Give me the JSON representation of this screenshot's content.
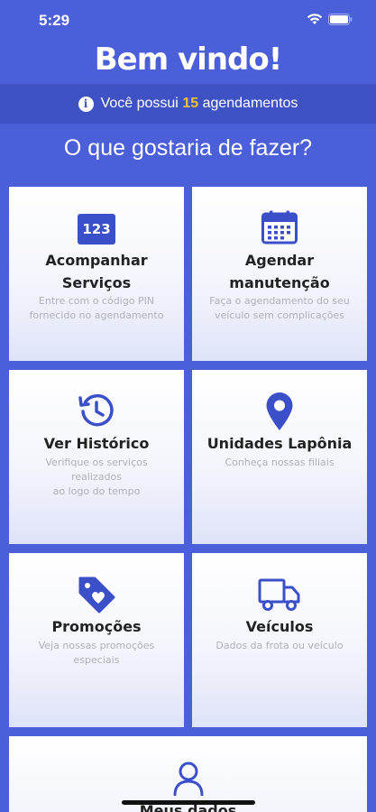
{
  "status_bar": {
    "time": "5:29",
    "icons": [
      "wifi-icon",
      "battery-icon"
    ]
  },
  "header": {
    "title": "Bem vindo!",
    "info_prefix": "Você possui",
    "appointments_count": "15",
    "info_suffix": "agendamentos"
  },
  "question": "O que gostaria de fazer?",
  "cards": [
    {
      "icon": "pin-code-icon",
      "icon_text": "123",
      "title_line1": "Acompanhar",
      "title_line2": "Serviços",
      "desc_line1": "Entre com o código PIN",
      "desc_line2": "fornecido no agendamento"
    },
    {
      "icon": "calendar-icon",
      "title_line1": "Agendar",
      "title_line2": "manutenção",
      "desc_line1": "Faça o agendamento do seu",
      "desc_line2": "veículo sem complicações"
    },
    {
      "icon": "history-icon",
      "title_line1": "Ver Histórico",
      "desc_line1": "Verifique os serviços realizados",
      "desc_line2": "ao logo do tempo"
    },
    {
      "icon": "location-pin-icon",
      "title_line1": "Unidades Lapônia",
      "desc_line1": "Conheça nossas filiais"
    },
    {
      "icon": "promo-tag-icon",
      "title_line1": "Promoções",
      "desc_line1": "Veja nossas promoções",
      "desc_line2": "especiais"
    },
    {
      "icon": "truck-icon",
      "title_line1": "Veículos",
      "desc_line1": "Dados da frota ou veículo"
    },
    {
      "icon": "user-icon",
      "title_line1": "Meus dados"
    }
  ],
  "colors": {
    "background": "#4a5fd8",
    "info_bar": "#3f52c4",
    "accent_count": "#f5c03a",
    "icon": "#3a4fc8"
  }
}
